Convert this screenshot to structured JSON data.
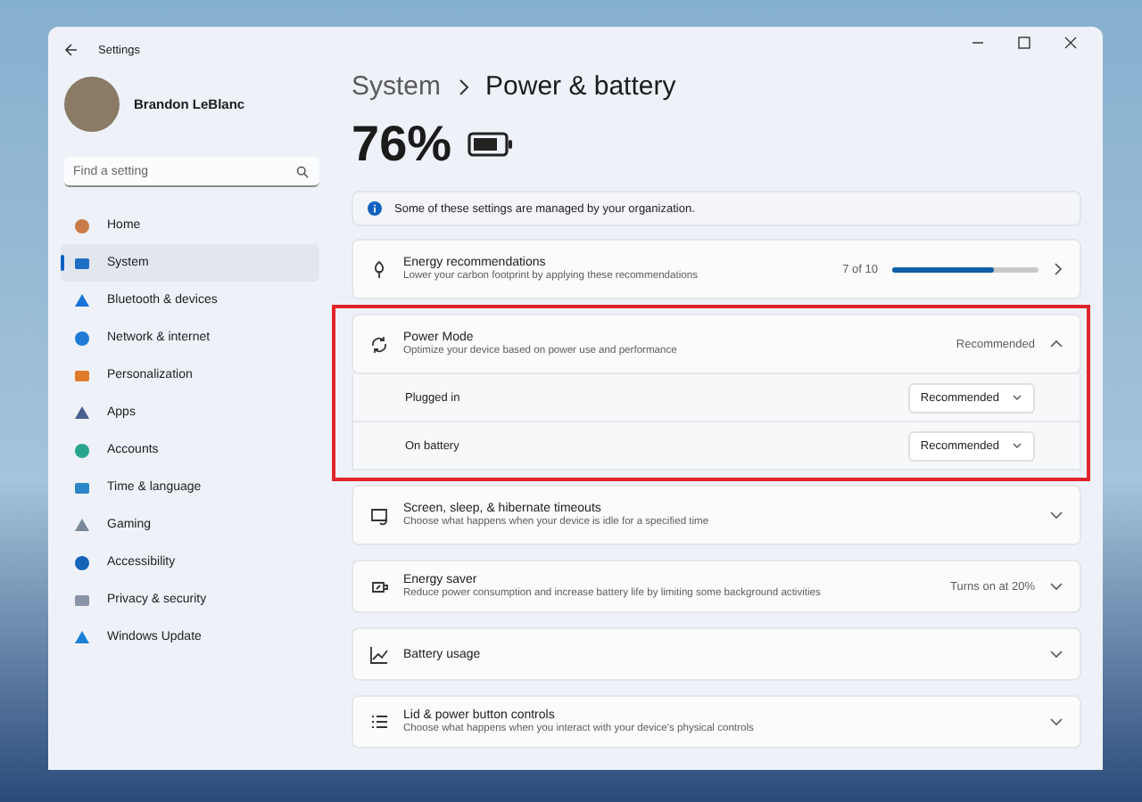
{
  "window": {
    "title": "Settings"
  },
  "user": {
    "name": "Brandon LeBlanc"
  },
  "search": {
    "placeholder": "Find a setting"
  },
  "sidebar": {
    "items": [
      {
        "label": "Home",
        "selected": false
      },
      {
        "label": "System",
        "selected": true
      },
      {
        "label": "Bluetooth & devices",
        "selected": false
      },
      {
        "label": "Network & internet",
        "selected": false
      },
      {
        "label": "Personalization",
        "selected": false
      },
      {
        "label": "Apps",
        "selected": false
      },
      {
        "label": "Accounts",
        "selected": false
      },
      {
        "label": "Time & language",
        "selected": false
      },
      {
        "label": "Gaming",
        "selected": false
      },
      {
        "label": "Accessibility",
        "selected": false
      },
      {
        "label": "Privacy & security",
        "selected": false
      },
      {
        "label": "Windows Update",
        "selected": false
      }
    ]
  },
  "breadcrumb": [
    "System",
    "Power & battery"
  ],
  "battery": {
    "percent": "76%"
  },
  "notice": "Some of these settings are managed by your organization.",
  "cards": [
    {
      "kind": "progress",
      "title": "Energy recommendations",
      "description": "Lower your carbon footprint by applying these recommendations",
      "value": "7 of 10",
      "level": 0.7
    },
    {
      "kind": "expander",
      "title": "Power Mode",
      "description": "Optimize your device based on power use and performance",
      "value": "Recommended",
      "expanded": true,
      "options": [
        {
          "label": "Plugged in",
          "value": "Recommended"
        },
        {
          "label": "On battery",
          "value": "Recommended"
        }
      ]
    },
    {
      "kind": "expander",
      "title": "Screen, sleep, & hibernate timeouts",
      "description": "Choose what happens when your device is idle for a specified time",
      "expanded": false
    },
    {
      "kind": "expander",
      "title": "Energy saver",
      "description": "Reduce power consumption and increase battery life by limiting some background activities",
      "value": "Turns on at 20%",
      "expanded": false
    },
    {
      "kind": "expander",
      "title": "Battery usage",
      "expanded": false
    },
    {
      "kind": "expander",
      "title": "Lid & power button controls",
      "description": "Choose what happens when you interact with your device's physical controls",
      "expanded": false
    }
  ]
}
